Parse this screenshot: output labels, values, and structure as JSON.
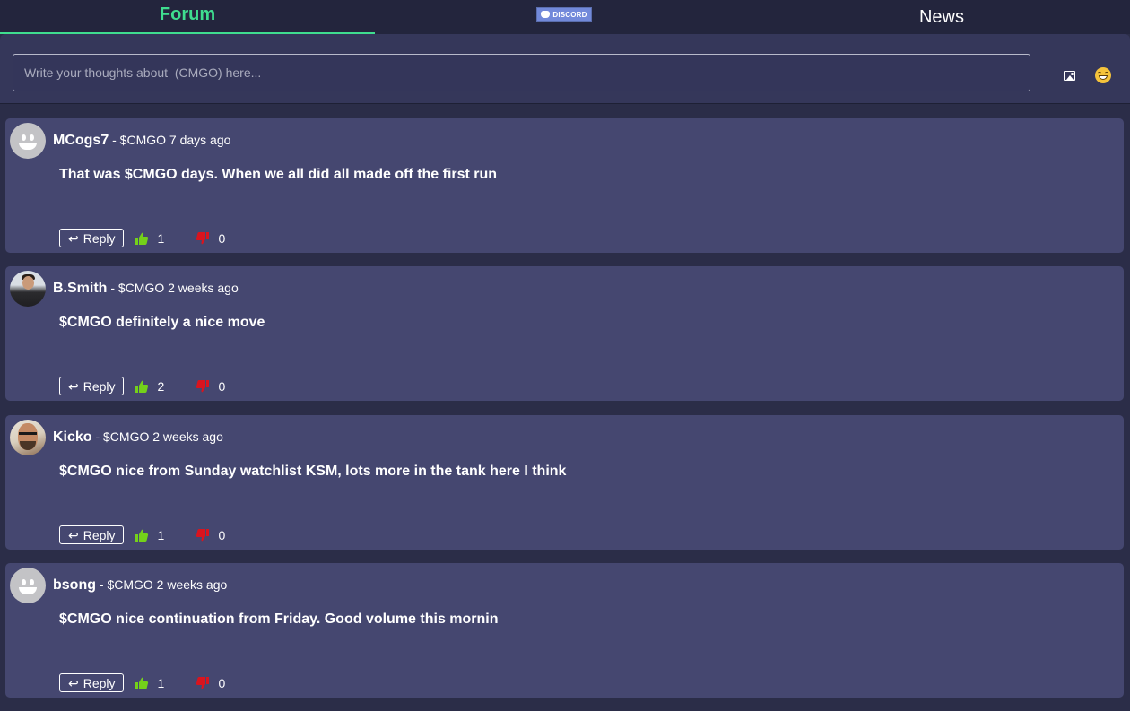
{
  "tabs": {
    "forum": "Forum",
    "discord": "DISCORD",
    "news": "News"
  },
  "composer": {
    "placeholder": "Write your thoughts about  (CMGO) here...",
    "image_icon": "image-icon",
    "emoji_icon": "smiley-emoji-icon"
  },
  "colors": {
    "accent": "#3fdd8f",
    "like": "#74d11a",
    "dislike": "#d9141e",
    "discord": "#7289da"
  },
  "posts": [
    {
      "username": "MCogs7",
      "meta": "- $CMGO 7 days ago",
      "body": "That was $CMGO days. When we all did all made off the first run",
      "reply_label": "Reply",
      "likes": "1",
      "dislikes": "0",
      "avatar": "default-smiley"
    },
    {
      "username": "B.Smith",
      "meta": "- $CMGO 2 weeks ago",
      "body": "$CMGO definitely a nice move",
      "reply_label": "Reply",
      "likes": "2",
      "dislikes": "0",
      "avatar": "photo"
    },
    {
      "username": "Kicko",
      "meta": "- $CMGO 2 weeks ago",
      "body": "$CMGO nice from Sunday watchlist KSM, lots more in the tank here I think",
      "reply_label": "Reply",
      "likes": "1",
      "dislikes": "0",
      "avatar": "photo"
    },
    {
      "username": "bsong",
      "meta": "- $CMGO 2 weeks ago",
      "body": "$CMGO nice continuation from Friday. Good volume this mornin",
      "reply_label": "Reply",
      "likes": "1",
      "dislikes": "0",
      "avatar": "default-smiley"
    }
  ]
}
